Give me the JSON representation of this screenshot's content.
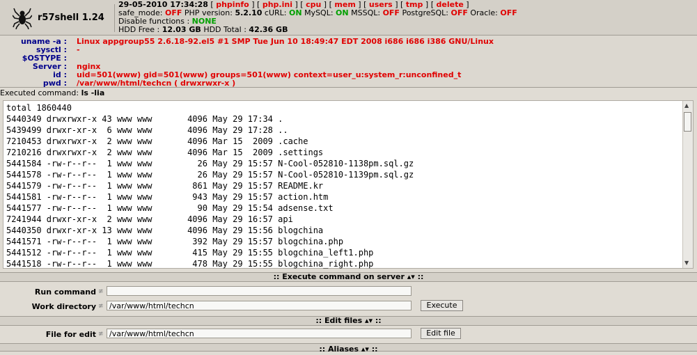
{
  "app": {
    "title": "r57shell 1.24"
  },
  "header": {
    "datetime": "29-05-2010 17:34:28",
    "links": [
      "phpinfo",
      "php.ini",
      "cpu",
      "mem",
      "users",
      "tmp",
      "delete"
    ],
    "safe_mode_label": "safe_mode:",
    "safe_mode_val": "OFF",
    "php_label": "PHP version:",
    "php_val": "5.2.10",
    "curl_label": "cURL:",
    "curl_val": "ON",
    "mysql_label": "MySQL:",
    "mysql_val": "ON",
    "mssql_label": "MSSQL:",
    "mssql_val": "OFF",
    "pg_label": "PostgreSQL:",
    "pg_val": "OFF",
    "oracle_label": "Oracle:",
    "oracle_val": "OFF",
    "disable_label": "Disable functions :",
    "disable_val": "NONE",
    "hdd_free_label": "HDD Free :",
    "hdd_free_val": "12.03 GB",
    "hdd_total_label": "HDD Total :",
    "hdd_total_val": "42.36 GB"
  },
  "sysinfo": [
    {
      "label": "uname -a :",
      "value": "Linux appgroup55 2.6.18-92.el5 #1 SMP Tue Jun 10 18:49:47 EDT 2008 i686 i686 i386 GNU/Linux"
    },
    {
      "label": "sysctl :",
      "value": "-"
    },
    {
      "label": "$OSTYPE :",
      "value": ""
    },
    {
      "label": "Server :",
      "value": "nginx"
    },
    {
      "label": "id :",
      "value": "uid=501(www) gid=501(www) groups=501(www) context=user_u:system_r:unconfined_t"
    },
    {
      "label": "pwd :",
      "value": "/var/www/html/techcn   ( drwxrwxr-x )"
    }
  ],
  "executed": {
    "label": "Executed command:",
    "command": "ls -lia"
  },
  "output": "total 1860440\n5440349 drwxrwxr-x 43 www www       4096 May 29 17:34 .\n5439499 drwxr-xr-x  6 www www       4096 May 29 17:28 ..\n7210453 drwxrwxr-x  2 www www       4096 Mar 15  2009 .cache\n7210216 drwxrwxr-x  2 www www       4096 Mar 15  2009 .settings\n5441584 -rw-r--r--  1 www www         26 May 29 15:57 N-Cool-052810-1138pm.sql.gz\n5441578 -rw-r--r--  1 www www         26 May 29 15:57 N-Cool-052810-1139pm.sql.gz\n5441579 -rw-r--r--  1 www www        861 May 29 15:57 README.kr\n5441581 -rw-r--r--  1 www www        943 May 29 15:57 action.htm\n5441577 -rw-r--r--  1 www www         90 May 29 15:54 adsense.txt\n7241944 drwxr-xr-x  2 www www       4096 May 29 16:57 api\n5440350 drwxr-xr-x 13 www www       4096 May 29 15:56 blogchina\n5441571 -rw-r--r--  1 www www        392 May 29 15:57 blogchina.php\n5441512 -rw-r--r--  1 www www        415 May 29 15:55 blogchina_left1.php\n5441518 -rw-r--r--  1 www www        478 May 29 15:55 blogchina_right.php",
  "exec_section": {
    "title": ":: Execute command on server ▴▾ ::",
    "run_label": "Run command",
    "run_value": "",
    "workdir_label": "Work directory",
    "workdir_value": "/var/www/html/techcn",
    "execute_btn": "Execute"
  },
  "edit_section": {
    "title": ":: Edit files ▴▾ ::",
    "file_label": "File for edit",
    "file_value": "/var/www/html/techcn",
    "edit_btn": "Edit file"
  },
  "aliases_section": {
    "title": ":: Aliases ▴▾ ::"
  },
  "icons": {
    "logo": "spider-icon",
    "field_arrow": "double-arrow-icon"
  }
}
